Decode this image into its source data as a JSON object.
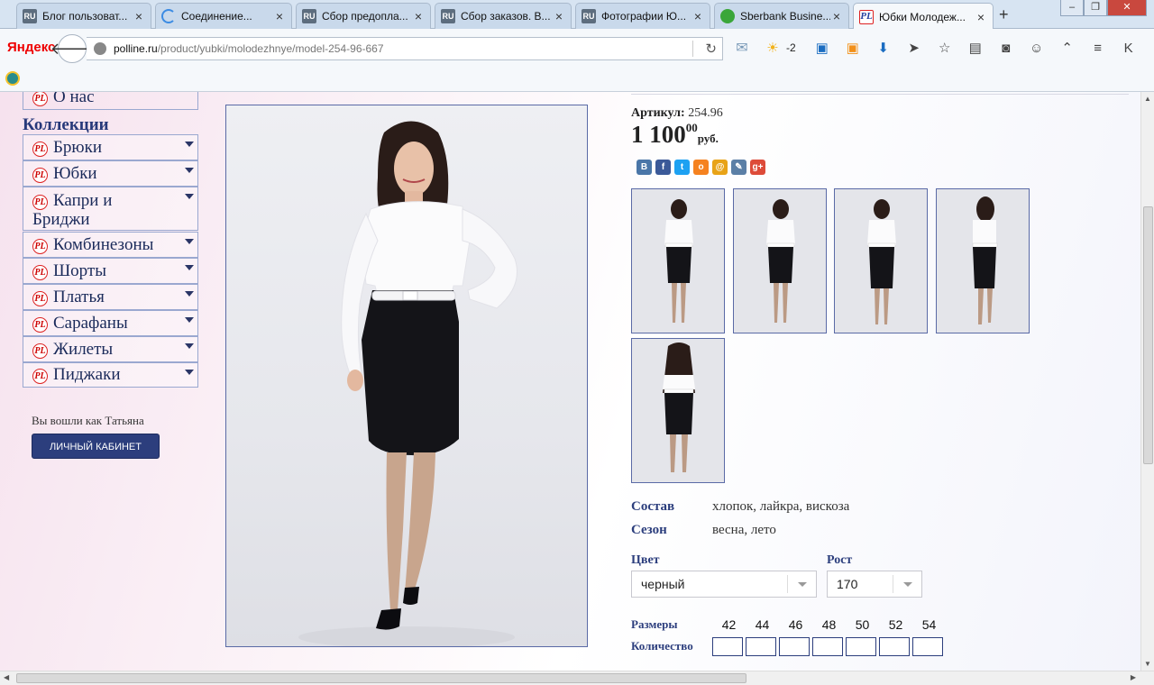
{
  "browser": {
    "tabs": [
      {
        "icon": "ru-icon",
        "title": "Блог пользоват..."
      },
      {
        "icon": "loading-icon",
        "title": "Соединение..."
      },
      {
        "icon": "ru-icon",
        "title": "Сбор предопла..."
      },
      {
        "icon": "ru-icon",
        "title": "Сбор заказов. В..."
      },
      {
        "icon": "ru-icon",
        "title": "Фотографии Ю..."
      },
      {
        "icon": "sberbank-icon",
        "title": "Sberbank Busine..."
      },
      {
        "icon": "polline-icon",
        "title": "Юбки Молодеж..."
      }
    ],
    "ru_badge": "RU",
    "pl_badge": "PL",
    "yandex_logo": "Яндекс",
    "url_host": "polline.ru",
    "url_path": "/product/yubki/molodezhnye/model-254-96-667",
    "weather_temp": "-2"
  },
  "sidebar": {
    "about": "О нас",
    "collections_title": "Коллекции",
    "pl_badge": "PL",
    "items": [
      {
        "label": "Брюки"
      },
      {
        "label": "Юбки"
      },
      {
        "label": "Капри и Бриджи"
      },
      {
        "label": "Комбинезоны"
      },
      {
        "label": "Шорты"
      },
      {
        "label": "Платья"
      },
      {
        "label": "Сарафаны"
      },
      {
        "label": "Жилеты"
      },
      {
        "label": "Пиджаки"
      }
    ],
    "logged_in_text": "Вы вошли как Татьяна",
    "cabinet_button": "ЛИЧНЫЙ КАБИНЕТ"
  },
  "product": {
    "article_label": "Артикул:",
    "article_value": "254.96",
    "price_main": "1 100",
    "price_cents": "00",
    "price_currency": "руб.",
    "social": [
      {
        "name": "vk-icon",
        "glyph": "В",
        "color": "#4a76a8"
      },
      {
        "name": "facebook-icon",
        "glyph": "f",
        "color": "#3b5998"
      },
      {
        "name": "twitter-icon",
        "glyph": "t",
        "color": "#1da1f2"
      },
      {
        "name": "odnoklassniki-icon",
        "glyph": "о",
        "color": "#f58220"
      },
      {
        "name": "mailru-icon",
        "glyph": "@",
        "color": "#e8a317"
      },
      {
        "name": "livejournal-icon",
        "glyph": "✎",
        "color": "#5b7fa6"
      },
      {
        "name": "googleplus-icon",
        "glyph": "g+",
        "color": "#dd4b39"
      }
    ],
    "composition_label": "Состав",
    "composition_value": "хлопок, лайкра, вискоза",
    "season_label": "Сезон",
    "season_value": "весна, лето",
    "color_label": "Цвет",
    "color_value": "черный",
    "height_label": "Рост",
    "height_value": "170",
    "sizes_label": "Размеры",
    "sizes": [
      "42",
      "44",
      "46",
      "48",
      "50",
      "52",
      "54"
    ],
    "quantity_label": "Количество"
  }
}
